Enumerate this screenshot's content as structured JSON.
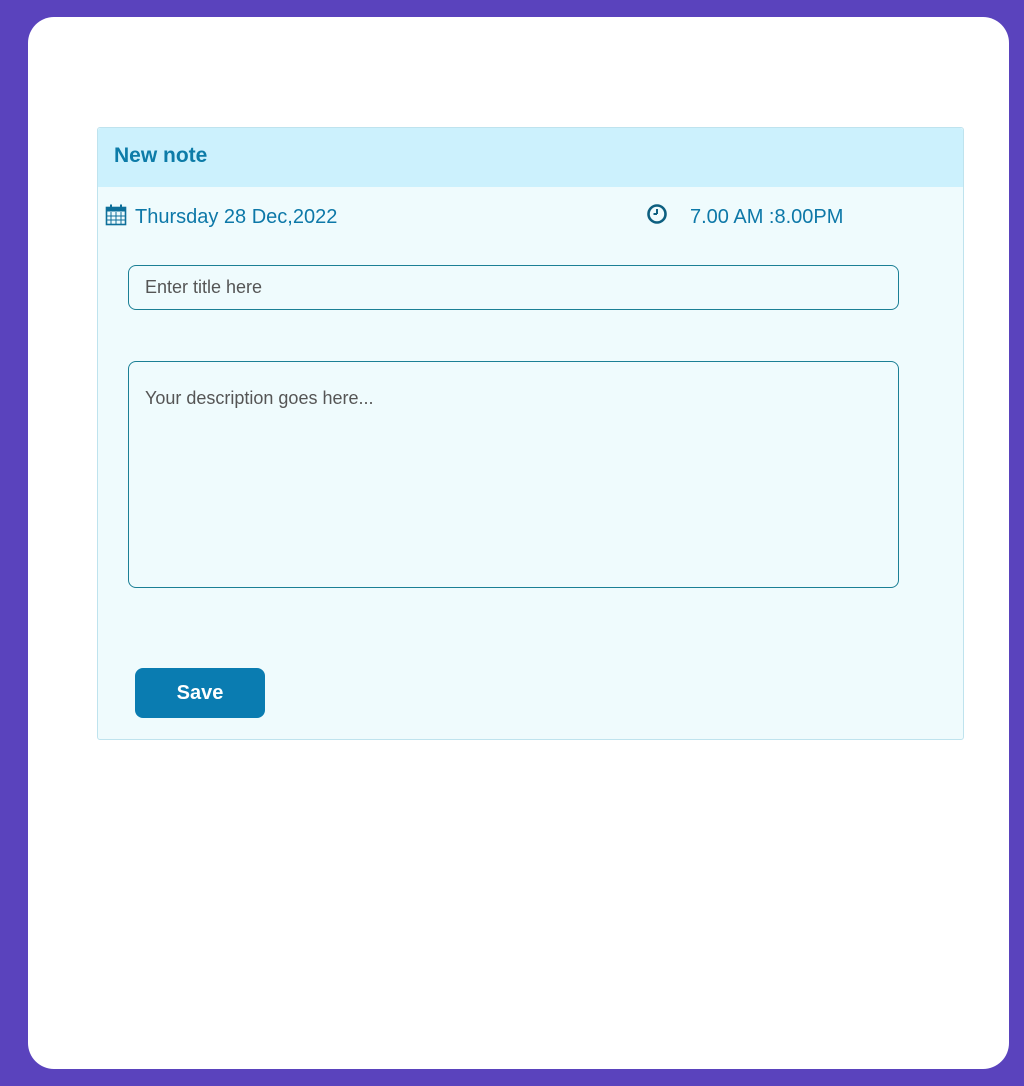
{
  "note": {
    "header_title": "New note",
    "date": "Thursday 28 Dec,2022",
    "time": "7.00 AM :8.00PM",
    "title_field": {
      "placeholder": "Enter title here",
      "value": ""
    },
    "description_field": {
      "placeholder": "Your description goes here...",
      "value": ""
    },
    "save_label": "Save"
  },
  "icons": {
    "date": "calendar-icon",
    "time": "clock-icon"
  },
  "colors": {
    "frame": "#5a43bd",
    "header_bg": "#ccf1fd",
    "card_bg": "#effbfd",
    "accent": "#0a7cb1",
    "text_accent": "#0d78a8"
  }
}
